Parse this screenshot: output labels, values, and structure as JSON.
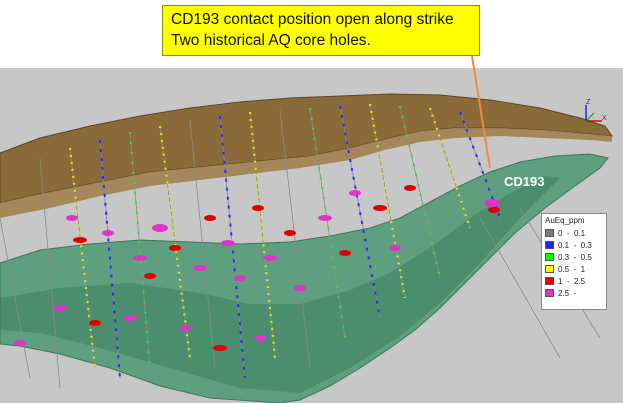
{
  "callout": {
    "line1": "CD193 contact position open along strike",
    "line2": "Two historical AQ core holes."
  },
  "hole_label": "CD193",
  "legend": {
    "title": "AuEq_ppm",
    "items": [
      {
        "label": "0  -  0.1",
        "color": "#7a7a7a"
      },
      {
        "label": "0.1  -  0.3",
        "color": "#1f1fff"
      },
      {
        "label": "0.3  -  0.5",
        "color": "#00ff00"
      },
      {
        "label": "0.5  -  1",
        "color": "#ffff00"
      },
      {
        "label": "1  -  2.5",
        "color": "#e00000"
      },
      {
        "label": "2.5  -",
        "color": "#e233c8"
      }
    ]
  },
  "axis_gizmo": {
    "z_label": "Z",
    "x_label": "X"
  },
  "colors": {
    "background": "#c7c7c7",
    "surface_brown": "#8b6a3a",
    "orebody_green": "#4f9a76",
    "callout_fill": "#ffff00",
    "leader_line": "#f08a3c"
  }
}
